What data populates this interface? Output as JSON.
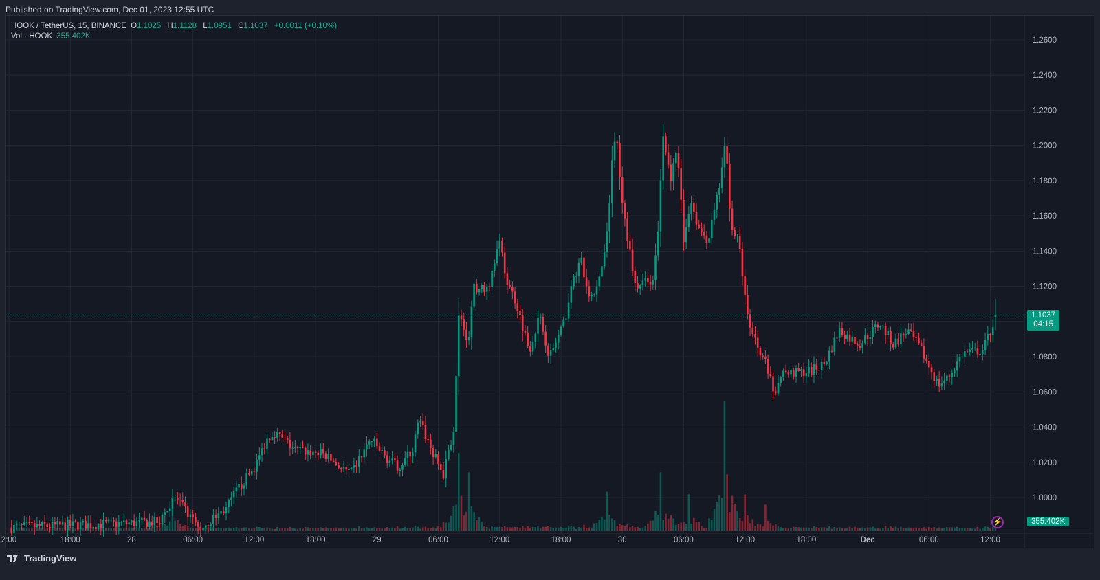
{
  "header": {
    "published": "Published on TradingView.com, Dec 01, 2023 12:55 UTC"
  },
  "legend": {
    "symbol": "HOOK / TetherUS, 15, BINANCE",
    "o_label": "O",
    "o": "1.1025",
    "h_label": "H",
    "h": "1.1128",
    "l_label": "L",
    "l": "1.0951",
    "c_label": "C",
    "c": "1.1037",
    "change": "+0.0011 (+0.10%)",
    "vol_label": "Vol · HOOK",
    "vol": "355.402K"
  },
  "price_tag": {
    "price": "1.1037",
    "countdown": "04:15"
  },
  "volume_tag": "355.402K",
  "footer": {
    "brand": "TradingView"
  },
  "colors": {
    "up": "#089981",
    "down": "#f23645",
    "grid": "#232733",
    "text": "#b2b5be"
  },
  "chart_data": {
    "type": "candlestick",
    "title": "HOOK / TetherUS, 15, BINANCE",
    "interval_minutes": 15,
    "y_ticks": [
      "1.2600",
      "1.2400",
      "1.2200",
      "1.2000",
      "1.1800",
      "1.1600",
      "1.1400",
      "1.1200",
      "1.1000",
      "1.0800",
      "1.0600",
      "1.0400",
      "1.0200",
      "1.0000"
    ],
    "ylim": [
      0.975,
      1.274
    ],
    "x_ticks": [
      {
        "hour": 0,
        "label": "2:00"
      },
      {
        "hour": 6,
        "label": "18:00"
      },
      {
        "hour": 12,
        "label": "28"
      },
      {
        "hour": 18,
        "label": "06:00"
      },
      {
        "hour": 24,
        "label": "12:00"
      },
      {
        "hour": 30,
        "label": "18:00"
      },
      {
        "hour": 36,
        "label": "29"
      },
      {
        "hour": 42,
        "label": "06:00"
      },
      {
        "hour": 48,
        "label": "12:00"
      },
      {
        "hour": 54,
        "label": "18:00"
      },
      {
        "hour": 60,
        "label": "30"
      },
      {
        "hour": 66,
        "label": "06:00"
      },
      {
        "hour": 72,
        "label": "12:00"
      },
      {
        "hour": 78,
        "label": "18:00"
      },
      {
        "hour": 84,
        "label": "Dec"
      },
      {
        "hour": 90,
        "label": "06:00"
      },
      {
        "hour": 96,
        "label": "12:00"
      }
    ],
    "price_path": [
      [
        0,
        0.983
      ],
      [
        14.6,
        0.986
      ],
      [
        16.3,
        1.0
      ],
      [
        18.6,
        0.982
      ],
      [
        21.3,
        0.994
      ],
      [
        22.3,
        1.004
      ],
      [
        24,
        1.017
      ],
      [
        25.4,
        1.035
      ],
      [
        26,
        1.037
      ],
      [
        28,
        1.027
      ],
      [
        30.7,
        1.025
      ],
      [
        33.4,
        1.013
      ],
      [
        35.4,
        1.033
      ],
      [
        36.8,
        1.023
      ],
      [
        38.1,
        1.017
      ],
      [
        39.5,
        1.027
      ],
      [
        40.1,
        1.044
      ],
      [
        41.5,
        1.025
      ],
      [
        42.5,
        1.013
      ],
      [
        43.5,
        1.039
      ],
      [
        44,
        1.103
      ],
      [
        44.9,
        1.087
      ],
      [
        45.5,
        1.119
      ],
      [
        46.9,
        1.119
      ],
      [
        47.9,
        1.148
      ],
      [
        48.6,
        1.125
      ],
      [
        49.6,
        1.111
      ],
      [
        50.9,
        1.084
      ],
      [
        51.9,
        1.103
      ],
      [
        52.9,
        1.08
      ],
      [
        54.3,
        1.099
      ],
      [
        55.3,
        1.126
      ],
      [
        56,
        1.134
      ],
      [
        56.6,
        1.115
      ],
      [
        57.6,
        1.119
      ],
      [
        58.4,
        1.142
      ],
      [
        59,
        1.189
      ],
      [
        59.4,
        1.208
      ],
      [
        60,
        1.165
      ],
      [
        60.7,
        1.142
      ],
      [
        61.3,
        1.119
      ],
      [
        62.3,
        1.126
      ],
      [
        63,
        1.123
      ],
      [
        63.5,
        1.15
      ],
      [
        64,
        1.205
      ],
      [
        64.7,
        1.181
      ],
      [
        65.4,
        1.197
      ],
      [
        66,
        1.146
      ],
      [
        66.7,
        1.169
      ],
      [
        67.4,
        1.154
      ],
      [
        68.4,
        1.146
      ],
      [
        69.4,
        1.173
      ],
      [
        70.1,
        1.201
      ],
      [
        70.7,
        1.15
      ],
      [
        71.4,
        1.146
      ],
      [
        72.1,
        1.107
      ],
      [
        72.8,
        1.091
      ],
      [
        73.8,
        1.08
      ],
      [
        74.8,
        1.06
      ],
      [
        75.8,
        1.07
      ],
      [
        78.5,
        1.072
      ],
      [
        79.8,
        1.076
      ],
      [
        81.2,
        1.095
      ],
      [
        83.2,
        1.087
      ],
      [
        85.2,
        1.099
      ],
      [
        86.5,
        1.087
      ],
      [
        87.9,
        1.095
      ],
      [
        89.2,
        1.084
      ],
      [
        90.9,
        1.064
      ],
      [
        91.9,
        1.068
      ],
      [
        93.3,
        1.082
      ],
      [
        95.3,
        1.084
      ],
      [
        96.6,
        1.1037
      ]
    ],
    "volume_spikes": [
      [
        16,
        0.25
      ],
      [
        44,
        0.6
      ],
      [
        45,
        0.45
      ],
      [
        58.5,
        0.3
      ],
      [
        63.8,
        0.45
      ],
      [
        66.5,
        0.28
      ],
      [
        70.1,
        1.0
      ],
      [
        72,
        0.28
      ],
      [
        74,
        0.2
      ]
    ],
    "last": {
      "open": 1.1025,
      "high": 1.1128,
      "low": 1.0951,
      "close": 1.1037,
      "volume": "355.402K"
    }
  }
}
